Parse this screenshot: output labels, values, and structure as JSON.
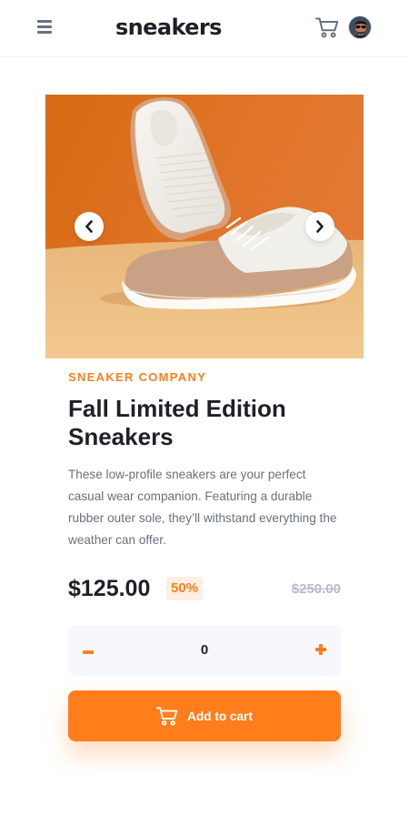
{
  "header": {
    "logo": "sneakers",
    "menu_icon": "menu-icon",
    "cart_icon": "cart-icon",
    "avatar_icon": "avatar"
  },
  "gallery": {
    "prev_icon": "chevron-left-icon",
    "next_icon": "chevron-right-icon"
  },
  "product": {
    "company": "SNEAKER COMPANY",
    "title": "Fall Limited Edition Sneakers",
    "description": "These low-profile sneakers are your perfect casual wear companion. Featuring a durable rubber outer sole, they’ll withstand everything the weather can offer.",
    "price": "$125.00",
    "discount": "50%",
    "original_price": "$250.00"
  },
  "quantity": {
    "value": "0",
    "minus_icon": "minus-icon",
    "plus_icon": "plus-icon"
  },
  "cart_button": {
    "label": "Add to cart",
    "icon": "cart-icon"
  },
  "colors": {
    "accent": "#ff7e1b",
    "accent_pale": "#ffeee2",
    "text_dark": "#1d2026",
    "text_muted": "#69707d",
    "text_faint": "#b6bcc8",
    "surface": "#f7f8fd"
  }
}
